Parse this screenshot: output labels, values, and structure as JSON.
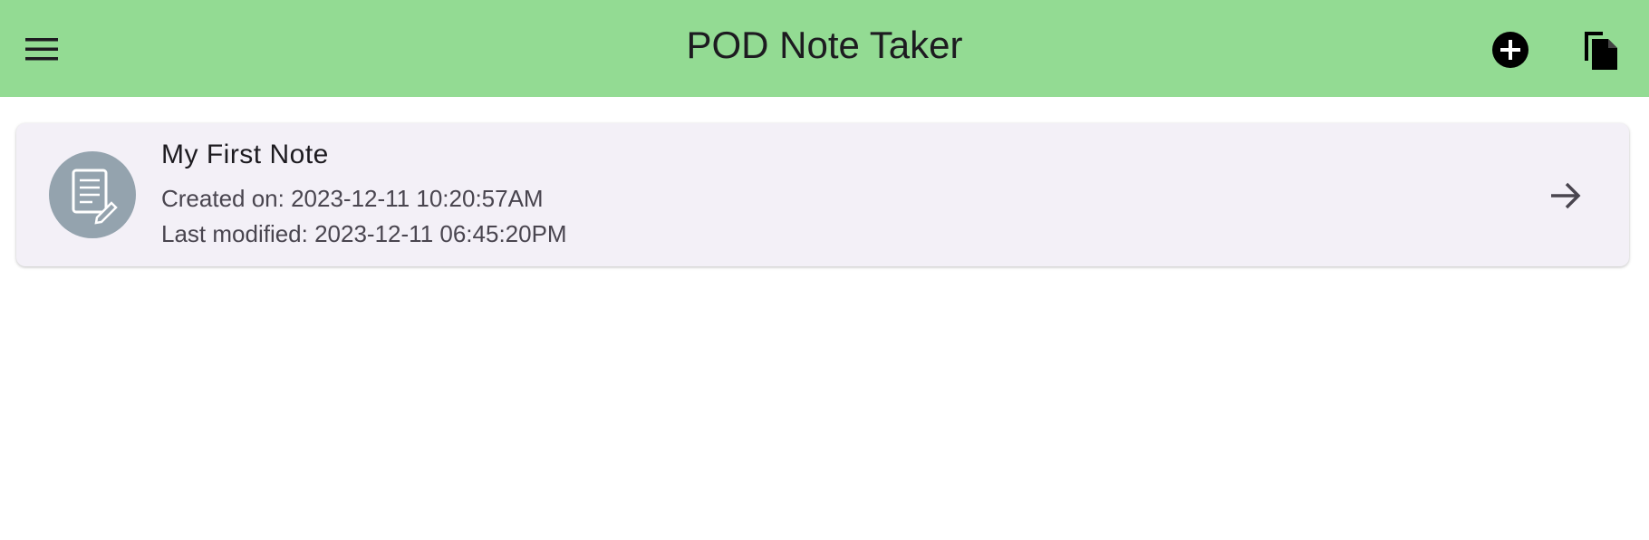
{
  "appbar": {
    "title": "POD Note Taker",
    "background_color": "#93db93",
    "menu_icon": "hamburger-menu-icon",
    "actions": [
      {
        "name": "add-note",
        "icon": "add-circle-icon"
      },
      {
        "name": "files",
        "icon": "copy-documents-icon"
      }
    ]
  },
  "notes": [
    {
      "title": "My First Note",
      "created": "Created on: 2023-12-11 10:20:57AM",
      "modified": "Last modified: 2023-12-11 06:45:20PM",
      "icon": "note-edit-icon",
      "trailing_icon": "arrow-forward-icon"
    }
  ]
}
